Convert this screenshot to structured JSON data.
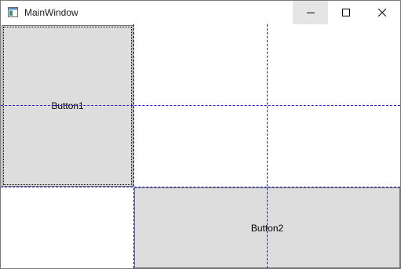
{
  "window": {
    "title": "MainWindow",
    "icons": {
      "app": "window-app-icon",
      "minimize": "minimize-icon",
      "maximize": "maximize-icon",
      "close": "close-icon"
    }
  },
  "content": {
    "button1_label": "Button1",
    "button2_label": "Button2"
  },
  "colors": {
    "gridline": "#2222cc",
    "button_face": "#dddddd",
    "button_border": "#707070",
    "minimize_hover": "#e5e5e5"
  }
}
